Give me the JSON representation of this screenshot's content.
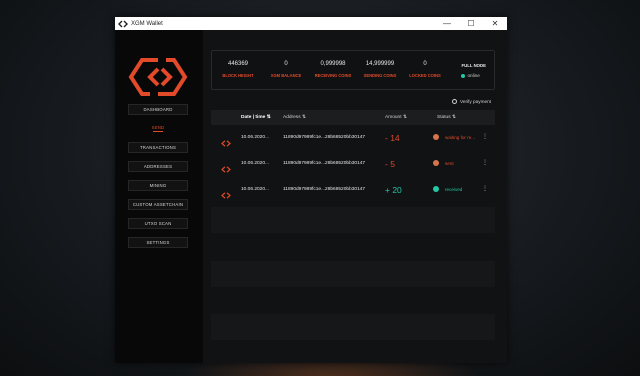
{
  "window": {
    "title": "XGM Wallet"
  },
  "titlebar_controls": {
    "minimize": "—",
    "maximize": "☐",
    "close": "✕"
  },
  "sidebar": {
    "items": [
      {
        "label": "DASHBOARD",
        "active": false
      },
      {
        "label": "SEND",
        "active": true
      },
      {
        "label": "TRANSACTIONS",
        "active": false
      },
      {
        "label": "ADDRESSES",
        "active": false
      },
      {
        "label": "MINING",
        "active": false
      },
      {
        "label": "CUSTOM ASSETCHAIN",
        "active": false
      },
      {
        "label": "UTXO SCAN",
        "active": false
      },
      {
        "label": "SETTINGS",
        "active": false
      }
    ]
  },
  "stats": [
    {
      "value": "446369",
      "label": "BLOCK HEIGHT"
    },
    {
      "value": "0",
      "label": "XGM BALANCE"
    },
    {
      "value": "0,999998",
      "label": "RECEIVING COINS"
    },
    {
      "value": "14,999999",
      "label": "SENDING COINS"
    },
    {
      "value": "0",
      "label": "LOCKED COINS"
    }
  ],
  "node": {
    "label": "FULL NODE",
    "state": "online"
  },
  "verify": {
    "label": "Verify payment"
  },
  "table": {
    "headers": {
      "date": "Date | time ⇅",
      "address": "Address ⇅",
      "amount": "Amount ⇅",
      "status": "Status ⇅"
    },
    "rows": [
      {
        "date": "10.06.2020...",
        "address": "11890d97989fc1e...28b68520bb30147",
        "amount": "- 14",
        "status": "waiting for re...",
        "status_color": "#e24a2a",
        "dot_color": "#d8744a"
      },
      {
        "date": "10.06.2020...",
        "address": "11890d97989fc1e...28b68520bb30147",
        "amount": "- 5",
        "status": "sent",
        "status_color": "#e24a2a",
        "dot_color": "#d8744a"
      },
      {
        "date": "10.06.2020...",
        "address": "11890d97989fc1e...28b68520bb30147",
        "amount": "+ 20",
        "status": "received",
        "status_color": "#24c7a6",
        "dot_color": "#24c7a6"
      }
    ]
  },
  "colors": {
    "accent": "#e24a2a",
    "success": "#24c7a6"
  },
  "icons": {
    "logo": "xgm-logo-icon",
    "verify": "verify-check-icon",
    "more": "more-vertical-icon"
  }
}
